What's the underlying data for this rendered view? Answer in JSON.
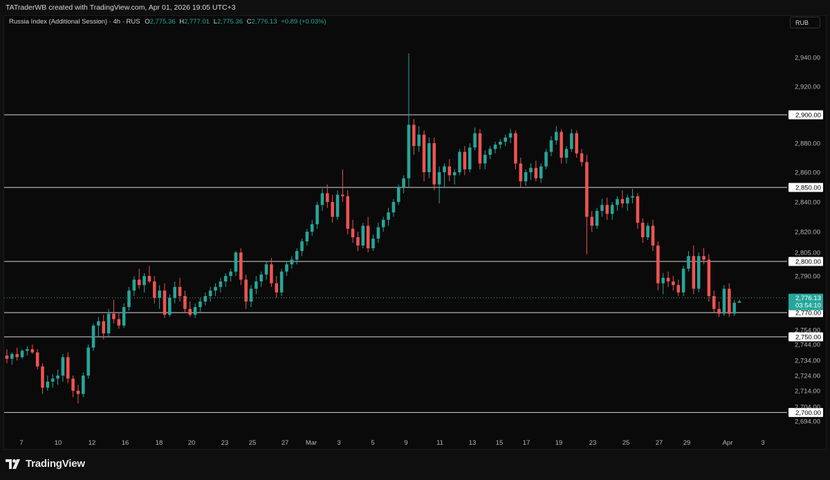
{
  "attribution": "TATraderWB created with TradingView.com, Apr 01, 2026 19:05 UTC+3",
  "legend": {
    "symbol": "Russia Index (Additional Session) · 4h · RUS",
    "o_label": "O",
    "o": "2,775.36",
    "h_label": "H",
    "h": "2,777.01",
    "l_label": "L",
    "l": "2,775.36",
    "c_label": "C",
    "c": "2,776.13",
    "change": "+0.89 (+0.03%)"
  },
  "currency": "RUB",
  "brand": "TradingView",
  "colors": {
    "up": "#26a69a",
    "down": "#ef5350",
    "background": "#0a0a0a",
    "level_line": "#d9d9d9",
    "price_tag": "#26a69a"
  },
  "chart_data": {
    "type": "candlestick",
    "timeframe": "4h",
    "y_axis_ticks": [
      "2,940.00",
      "2,920.00",
      "2,880.00",
      "2,860.00",
      "2,840.00",
      "2,820.00",
      "2,805.00",
      "2,790.00",
      "2,754.00",
      "2,744.00",
      "2,734.00",
      "2,724.00",
      "2,714.00",
      "2,704.00",
      "2,694.00"
    ],
    "x_axis_ticks": [
      "7",
      "10",
      "12",
      "16",
      "18",
      "20",
      "23",
      "25",
      "27",
      "Mar",
      "3",
      "5",
      "9",
      "11",
      "13",
      "15",
      "17",
      "19",
      "23",
      "25",
      "27",
      "29",
      "Apr",
      "3"
    ],
    "horizontal_levels": [
      "2,900.00",
      "2,850.00",
      "2,800.00",
      "2,770.00",
      "2,750.00",
      "2,700.00"
    ],
    "last_price": {
      "value": "2,776.13",
      "countdown": "03:54:10"
    },
    "candles": [
      [
        2737,
        2741,
        2732,
        2735
      ],
      [
        2735,
        2739,
        2731,
        2738
      ],
      [
        2738,
        2742,
        2734,
        2736
      ],
      [
        2736,
        2741,
        2735,
        2740
      ],
      [
        2740,
        2743,
        2737,
        2741
      ],
      [
        2741,
        2744,
        2738,
        2739
      ],
      [
        2739,
        2741,
        2728,
        2730
      ],
      [
        2730,
        2732,
        2712,
        2716
      ],
      [
        2716,
        2724,
        2714,
        2720
      ],
      [
        2720,
        2725,
        2716,
        2722
      ],
      [
        2722,
        2728,
        2718,
        2724
      ],
      [
        2724,
        2738,
        2720,
        2736
      ],
      [
        2736,
        2739,
        2719,
        2722
      ],
      [
        2722,
        2724,
        2710,
        2714
      ],
      [
        2714,
        2718,
        2706,
        2712
      ],
      [
        2712,
        2726,
        2710,
        2724
      ],
      [
        2724,
        2744,
        2722,
        2742
      ],
      [
        2742,
        2760,
        2740,
        2758
      ],
      [
        2758,
        2766,
        2750,
        2762
      ],
      [
        2762,
        2768,
        2748,
        2752
      ],
      [
        2752,
        2772,
        2750,
        2769
      ],
      [
        2769,
        2777,
        2760,
        2764
      ],
      [
        2764,
        2770,
        2755,
        2758
      ],
      [
        2758,
        2775,
        2756,
        2773
      ],
      [
        2773,
        2784,
        2771,
        2782
      ],
      [
        2782,
        2790,
        2779,
        2788
      ],
      [
        2788,
        2795,
        2783,
        2785
      ],
      [
        2785,
        2792,
        2781,
        2790
      ],
      [
        2790,
        2797,
        2786,
        2787
      ],
      [
        2787,
        2790,
        2775,
        2778
      ],
      [
        2778,
        2785,
        2772,
        2782
      ],
      [
        2782,
        2786,
        2765,
        2768
      ],
      [
        2768,
        2780,
        2766,
        2778
      ],
      [
        2778,
        2787,
        2775,
        2784
      ],
      [
        2784,
        2789,
        2776,
        2779
      ],
      [
        2779,
        2782,
        2770,
        2772
      ],
      [
        2772,
        2776,
        2766,
        2768
      ],
      [
        2768,
        2775,
        2765,
        2773
      ],
      [
        2773,
        2778,
        2770,
        2776
      ],
      [
        2776,
        2781,
        2774,
        2779
      ],
      [
        2779,
        2784,
        2776,
        2782
      ],
      [
        2782,
        2786,
        2779,
        2784
      ],
      [
        2784,
        2789,
        2781,
        2787
      ],
      [
        2787,
        2792,
        2784,
        2790
      ],
      [
        2790,
        2795,
        2787,
        2793
      ],
      [
        2793,
        2806,
        2790,
        2805
      ],
      [
        2805,
        2808,
        2785,
        2788
      ],
      [
        2788,
        2791,
        2772,
        2776
      ],
      [
        2776,
        2785,
        2773,
        2783
      ],
      [
        2783,
        2790,
        2780,
        2787
      ],
      [
        2787,
        2793,
        2784,
        2791
      ],
      [
        2791,
        2800,
        2788,
        2798
      ],
      [
        2798,
        2802,
        2784,
        2786
      ],
      [
        2786,
        2790,
        2778,
        2781
      ],
      [
        2781,
        2795,
        2779,
        2793
      ],
      [
        2793,
        2800,
        2790,
        2798
      ],
      [
        2798,
        2803,
        2795,
        2801
      ],
      [
        2801,
        2808,
        2798,
        2806
      ],
      [
        2806,
        2815,
        2803,
        2813
      ],
      [
        2813,
        2822,
        2810,
        2820
      ],
      [
        2820,
        2828,
        2817,
        2825
      ],
      [
        2825,
        2840,
        2822,
        2838
      ],
      [
        2838,
        2849,
        2834,
        2846
      ],
      [
        2846,
        2852,
        2836,
        2840
      ],
      [
        2840,
        2845,
        2826,
        2830
      ],
      [
        2830,
        2848,
        2828,
        2845
      ],
      [
        2845,
        2862,
        2840,
        2844
      ],
      [
        2844,
        2848,
        2818,
        2822
      ],
      [
        2822,
        2828,
        2812,
        2816
      ],
      [
        2816,
        2820,
        2806,
        2810
      ],
      [
        2810,
        2826,
        2808,
        2824
      ],
      [
        2824,
        2830,
        2805,
        2808
      ],
      [
        2808,
        2818,
        2806,
        2815
      ],
      [
        2815,
        2826,
        2812,
        2823
      ],
      [
        2823,
        2830,
        2820,
        2828
      ],
      [
        2828,
        2836,
        2824,
        2833
      ],
      [
        2833,
        2842,
        2830,
        2840
      ],
      [
        2840,
        2852,
        2838,
        2850
      ],
      [
        2850,
        2858,
        2846,
        2856
      ],
      [
        2856,
        2943,
        2850,
        2893
      ],
      [
        2893,
        2897,
        2872,
        2878
      ],
      [
        2878,
        2892,
        2874,
        2886
      ],
      [
        2886,
        2889,
        2854,
        2860
      ],
      [
        2860,
        2884,
        2856,
        2880
      ],
      [
        2880,
        2884,
        2848,
        2852
      ],
      [
        2852,
        2864,
        2839,
        2860
      ],
      [
        2860,
        2866,
        2850,
        2864
      ],
      [
        2864,
        2869,
        2854,
        2858
      ],
      [
        2858,
        2862,
        2852,
        2860
      ],
      [
        2860,
        2876,
        2858,
        2874
      ],
      [
        2874,
        2878,
        2858,
        2862
      ],
      [
        2862,
        2880,
        2860,
        2877
      ],
      [
        2877,
        2891,
        2875,
        2887
      ],
      [
        2887,
        2890,
        2862,
        2866
      ],
      [
        2866,
        2875,
        2862,
        2872
      ],
      [
        2872,
        2878,
        2869,
        2876
      ],
      [
        2876,
        2881,
        2873,
        2879
      ],
      [
        2879,
        2883,
        2876,
        2881
      ],
      [
        2881,
        2886,
        2878,
        2884
      ],
      [
        2884,
        2890,
        2880,
        2887
      ],
      [
        2887,
        2889,
        2862,
        2866
      ],
      [
        2866,
        2870,
        2850,
        2854
      ],
      [
        2854,
        2862,
        2851,
        2860
      ],
      [
        2860,
        2866,
        2855,
        2863
      ],
      [
        2863,
        2868,
        2854,
        2856
      ],
      [
        2856,
        2866,
        2853,
        2864
      ],
      [
        2864,
        2876,
        2862,
        2874
      ],
      [
        2874,
        2885,
        2871,
        2882
      ],
      [
        2882,
        2892,
        2879,
        2888
      ],
      [
        2888,
        2890,
        2866,
        2870
      ],
      [
        2870,
        2878,
        2866,
        2876
      ],
      [
        2876,
        2890,
        2874,
        2887
      ],
      [
        2887,
        2889,
        2870,
        2873
      ],
      [
        2873,
        2876,
        2864,
        2867
      ],
      [
        2867,
        2872,
        2804,
        2830
      ],
      [
        2830,
        2834,
        2820,
        2824
      ],
      [
        2824,
        2836,
        2822,
        2834
      ],
      [
        2834,
        2842,
        2830,
        2838
      ],
      [
        2838,
        2843,
        2828,
        2832
      ],
      [
        2832,
        2840,
        2828,
        2838
      ],
      [
        2838,
        2844,
        2834,
        2842
      ],
      [
        2842,
        2848,
        2836,
        2839
      ],
      [
        2839,
        2845,
        2834,
        2843
      ],
      [
        2843,
        2849,
        2839,
        2844
      ],
      [
        2844,
        2846,
        2822,
        2826
      ],
      [
        2826,
        2829,
        2812,
        2816
      ],
      [
        2816,
        2826,
        2814,
        2824
      ],
      [
        2824,
        2828,
        2806,
        2810
      ],
      [
        2810,
        2813,
        2782,
        2786
      ],
      [
        2786,
        2792,
        2780,
        2789
      ],
      [
        2789,
        2793,
        2784,
        2787
      ],
      [
        2787,
        2790,
        2782,
        2785
      ],
      [
        2785,
        2788,
        2779,
        2781
      ],
      [
        2781,
        2797,
        2779,
        2795
      ],
      [
        2795,
        2806,
        2793,
        2803
      ],
      [
        2803,
        2810,
        2780,
        2783
      ],
      [
        2783,
        2805,
        2781,
        2803
      ],
      [
        2803,
        2808,
        2798,
        2801
      ],
      [
        2801,
        2804,
        2776,
        2779
      ],
      [
        2779,
        2782,
        2770,
        2772
      ],
      [
        2772,
        2776,
        2766,
        2769
      ],
      [
        2769,
        2785,
        2767,
        2783
      ],
      [
        2783,
        2786,
        2766,
        2769
      ],
      [
        2769,
        2777,
        2767,
        2775.36
      ],
      [
        2775.36,
        2777.01,
        2775.36,
        2776.13
      ]
    ]
  }
}
